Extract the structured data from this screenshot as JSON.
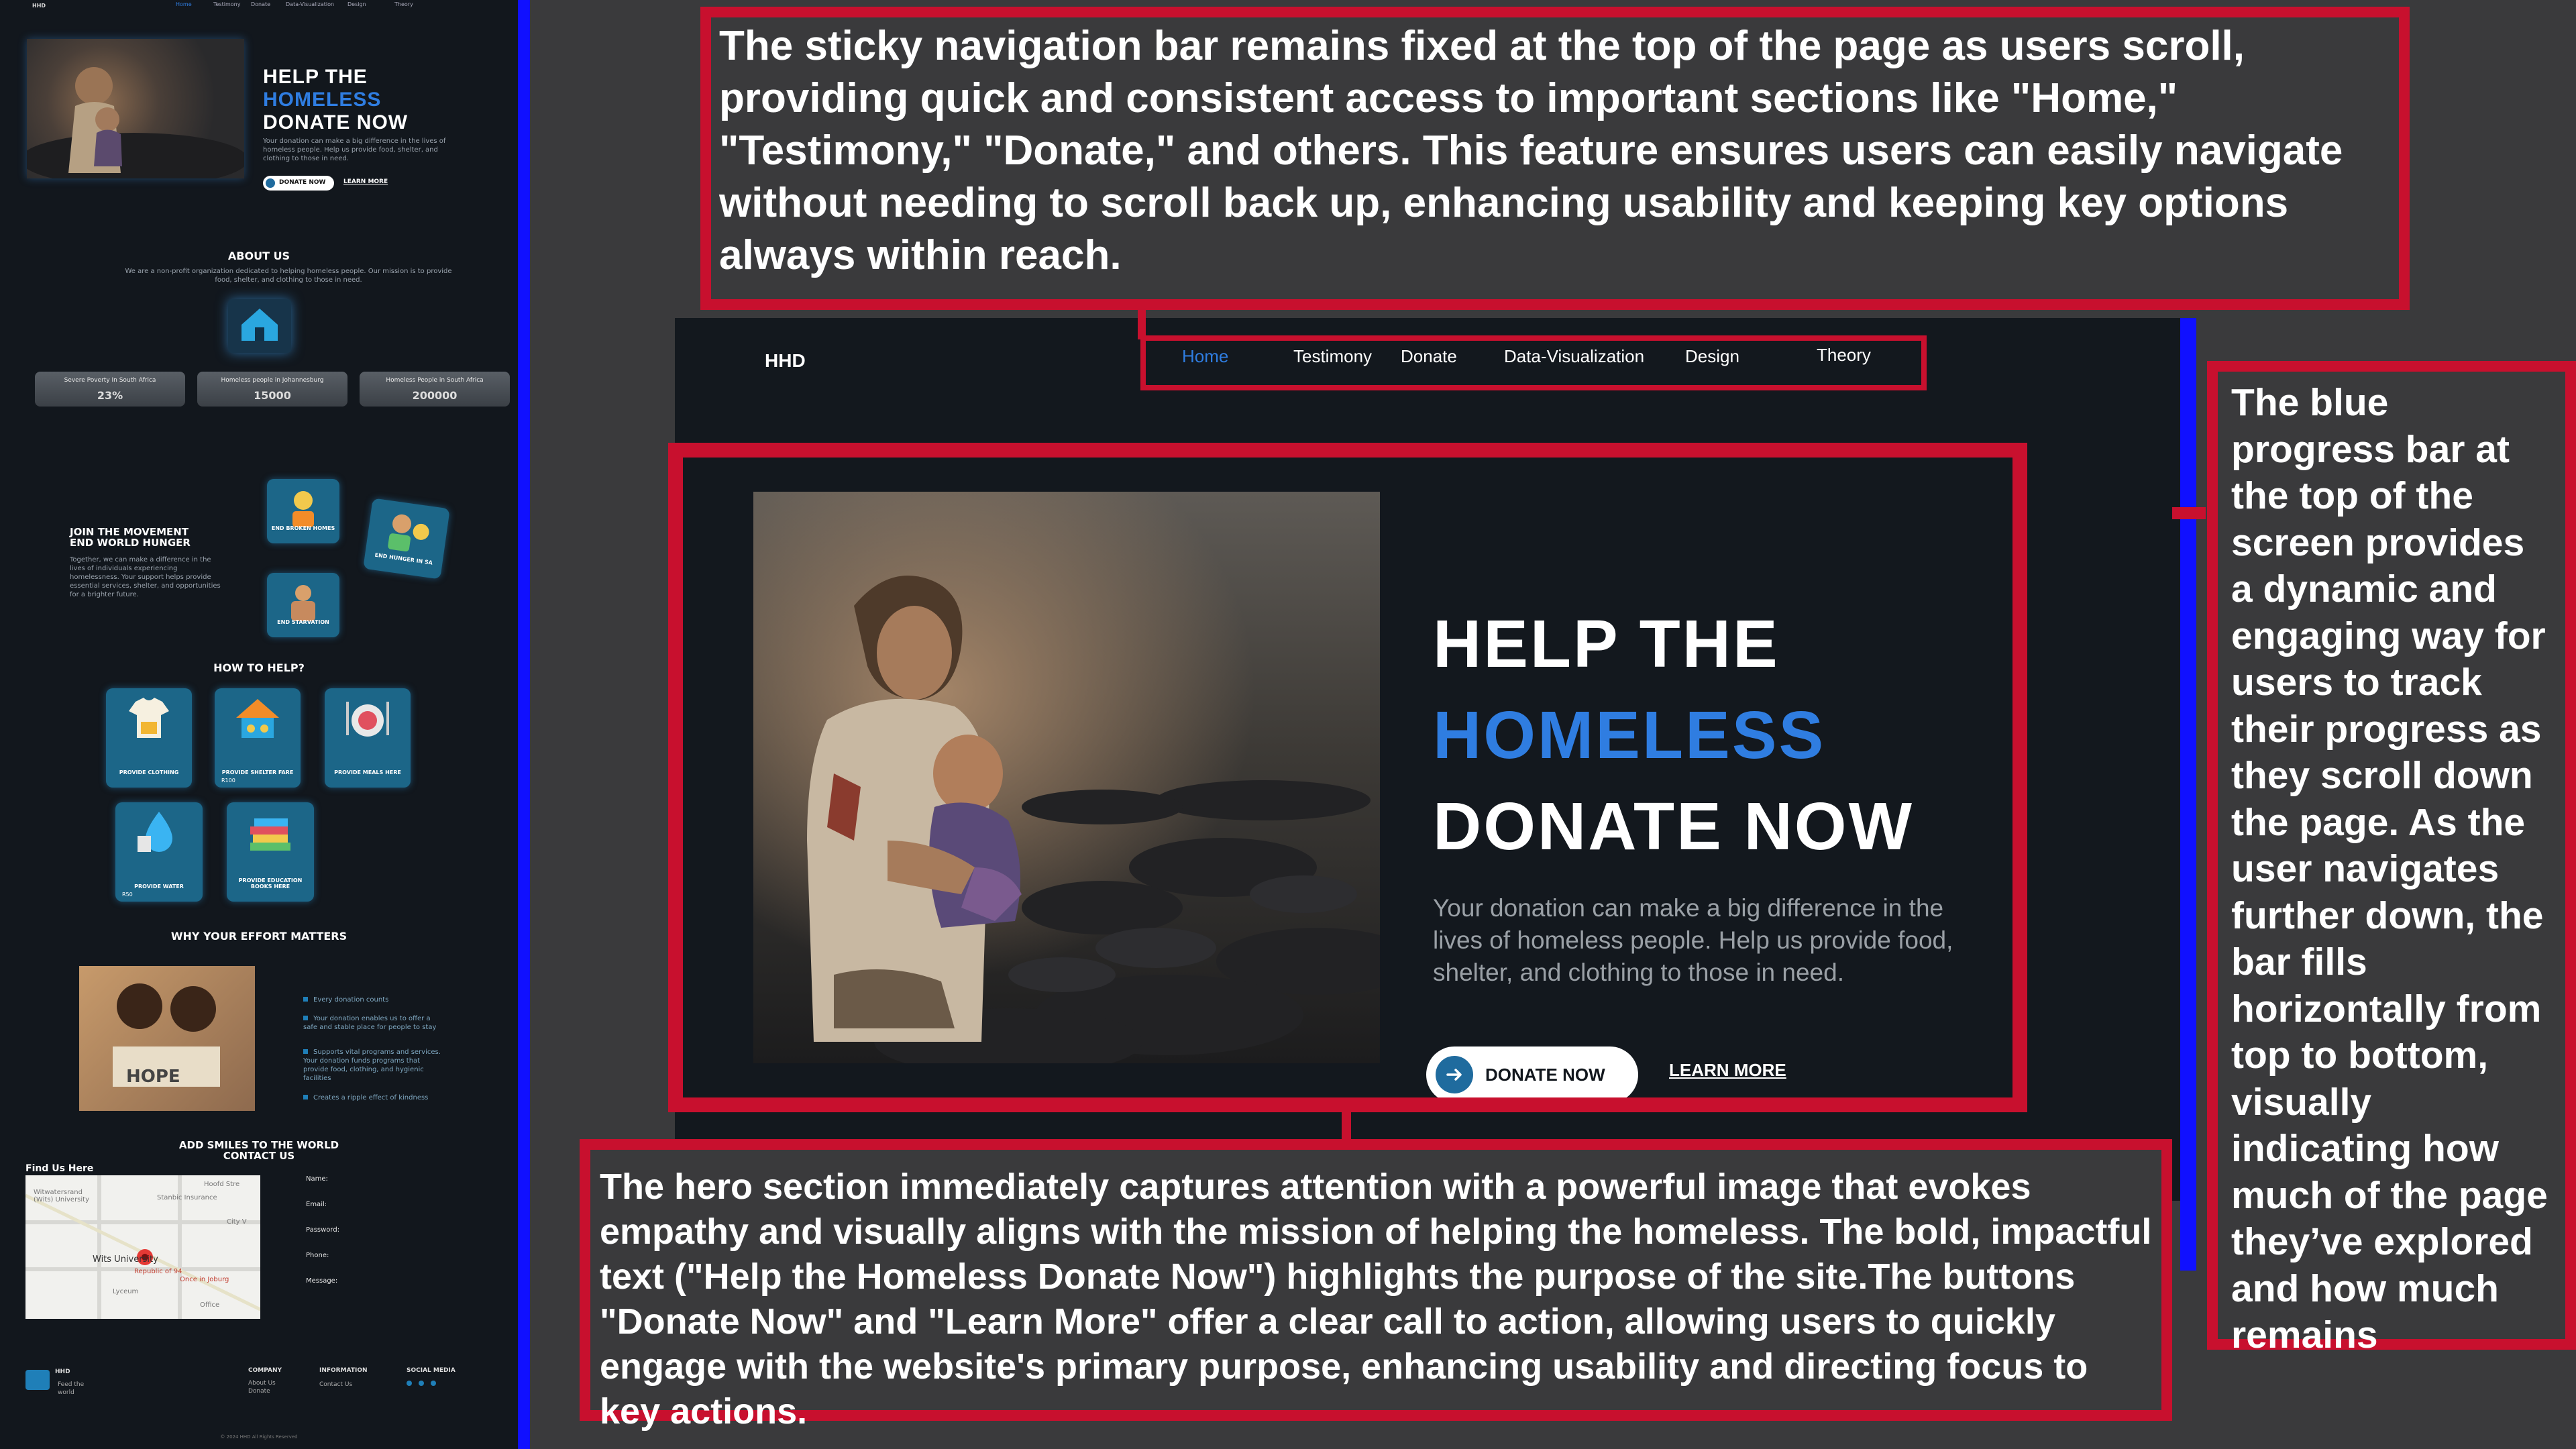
{
  "preview": {
    "logo": "HHD",
    "nav": [
      "Home",
      "Testimony",
      "Donate",
      "Data-Visualization",
      "Design",
      "Theory"
    ],
    "hero": {
      "title_line1": "HELP THE",
      "title_line2": "HOMELESS",
      "title_line3": "DONATE NOW",
      "desc": "Your donation can make a big difference in the lives of homeless people. Help us provide food, shelter, and clothing to those in need.",
      "donate": "DONATE NOW",
      "learn": "LEARN MORE"
    },
    "about": {
      "title": "ABOUT US",
      "text": "We are a non-profit organization dedicated to helping homeless people. Our mission is to provide food, shelter, and clothing to those in need."
    },
    "stats": [
      {
        "label": "Severe Poverty In South Africa",
        "value": "23%"
      },
      {
        "label": "Homeless people in Johannesburg",
        "value": "15000"
      },
      {
        "label": "Homeless People in South Africa",
        "value": "200000"
      }
    ],
    "movement": {
      "title1": "JOIN THE MOVEMENT",
      "title2": "END WORLD HUNGER",
      "text": "Together, we can make a difference in the lives of individuals experiencing homelessness. Your support helps provide essential services, shelter, and opportunities for a brighter future.",
      "badges": [
        "END BROKEN HOMES",
        "END HUNGER IN SA",
        "END STARVATION"
      ]
    },
    "help": {
      "title": "HOW TO HELP?",
      "cards": [
        {
          "caption": "PROVIDE CLOTHING",
          "price": ""
        },
        {
          "caption": "PROVIDE SHELTER FARE",
          "price": "R100"
        },
        {
          "caption": "PROVIDE MEALS HERE",
          "price": ""
        },
        {
          "caption": "PROVIDE WATER",
          "price": "R50"
        },
        {
          "caption": "PROVIDE EDUCATION BOOKS HERE",
          "price": ""
        }
      ]
    },
    "effort": {
      "title": "WHY YOUR EFFORT MATTERS",
      "hope": "HOPE",
      "bullets": [
        "Every donation counts",
        "Your donation enables us to offer a safe and stable place for people to stay",
        "Supports vital programs and services. Your donation funds programs that provide food, clothing, and hygienic facilities",
        "Creates a ripple effect of kindness"
      ]
    },
    "contact": {
      "title1": "ADD SMILES TO THE WORLD",
      "title2": "CONTACT US",
      "find": "Find Us Here",
      "map_labels": [
        "Witwatersrand (Wits) University",
        "Wits University",
        "Republic of 94",
        "Once in Joburg",
        "Lyceum",
        "Hoofd Stre",
        "Stanbic Insurance",
        "City V",
        "Office"
      ],
      "fields": [
        "Name:",
        "Email:",
        "Password:",
        "Phone:",
        "Message:"
      ]
    },
    "footer": {
      "logo": "HHD",
      "tagline": "Feed the world",
      "company": "COMPANY",
      "company_links": [
        "About Us",
        "Donate"
      ],
      "info": "INFORMATION",
      "info_links": [
        "Contact Us"
      ],
      "social": "SOCIAL MEDIA",
      "copyright": "© 2024 HHD All Rights Reserved"
    }
  },
  "main": {
    "logo": "HHD",
    "nav": [
      "Home",
      "Testimony",
      "Donate",
      "Data-Visualization",
      "Design",
      "Theory"
    ],
    "active_nav": "Home",
    "hero": {
      "title_line1": "HELP THE",
      "title_line2": "HOMELESS",
      "title_line3": "DONATE NOW",
      "desc": "Your donation can make a big difference in the lives of homeless people. Help us provide food, shelter, and clothing to those in need.",
      "donate": "DONATE NOW",
      "learn": "LEARN MORE"
    }
  },
  "annotations": {
    "nav": "The sticky navigation bar remains fixed at the top of the page as users scroll, providing quick and consistent access to important sections like \"Home,\" \"Testimony,\" \"Donate,\" and others. This feature ensures users can easily navigate without needing to scroll back up, enhancing usability and keeping key options always within reach.",
    "hero": "The hero section immediately captures attention with a powerful image that evokes empathy and visually aligns with the mission of helping the homeless. The bold, impactful text (\"Help the Homeless Donate Now\") highlights the purpose of the site.The buttons \"Donate Now\" and \"Learn More\" offer a clear call to action, allowing users to quickly engage with the website's primary purpose, enhancing usability and directing focus to key actions.",
    "progress": "The blue progress bar at the top of the screen provides a dynamic and engaging way for users to track their progress as they scroll down the page. As the user navigates further down, the bar fills horizontally from top to bottom, visually indicating how much of the page they’ve explored and how much remains"
  },
  "colors": {
    "accent_blue": "#2f7de1",
    "annotation_red": "#c8102e",
    "progress_blue": "#1010ff",
    "page_dark": "#13181e"
  }
}
